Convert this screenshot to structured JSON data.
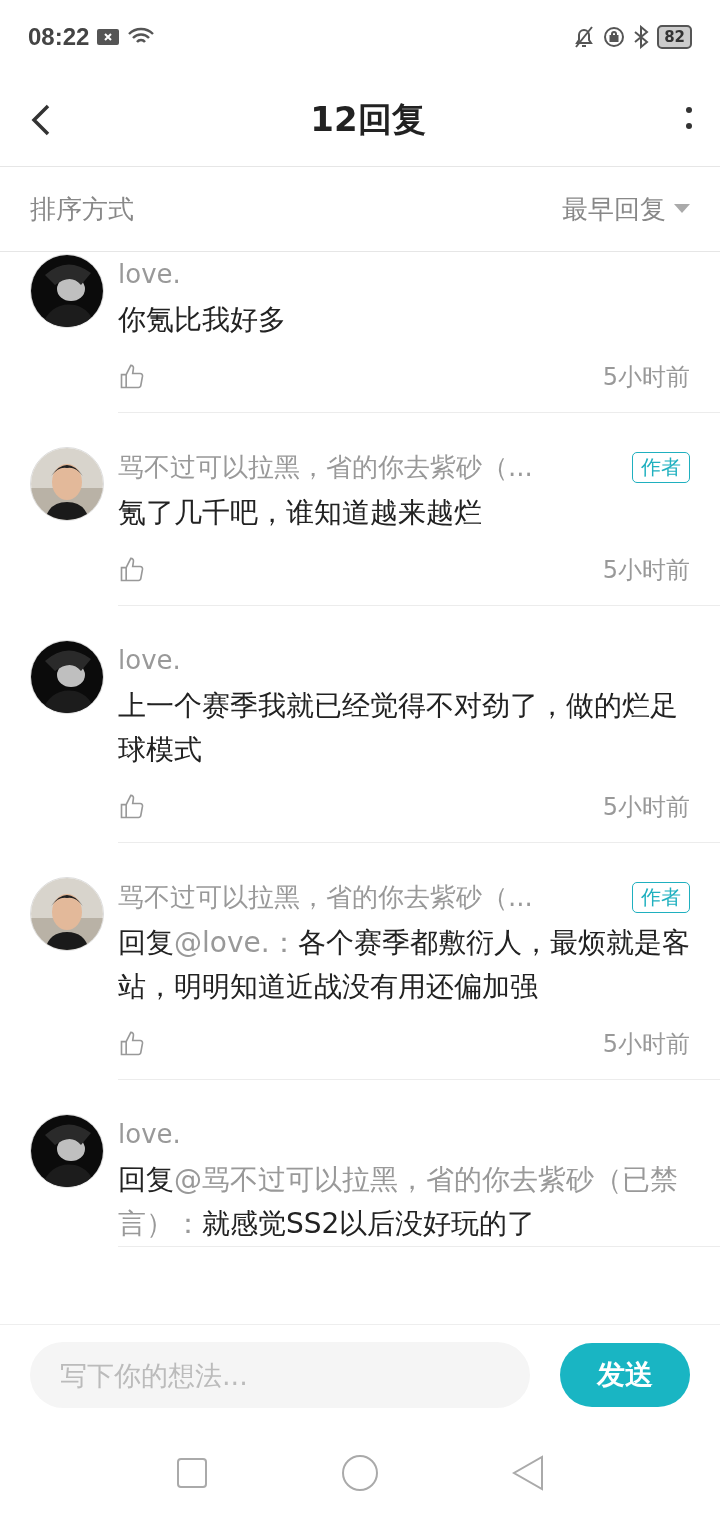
{
  "status_bar": {
    "time": "08:22",
    "battery": "82"
  },
  "header": {
    "title": "12回复"
  },
  "sort_bar": {
    "label": "排序方式",
    "value": "最早回复"
  },
  "comments": [
    {
      "name": "love.",
      "text": "你氪比我好多",
      "time": "5小时前"
    },
    {
      "name": "骂不过可以拉黑，省的你去紫砂（...",
      "badge": "作者",
      "text": "氪了几千吧，谁知道越来越烂",
      "time": "5小时前"
    },
    {
      "name": "love.",
      "text": "上一个赛季我就已经觉得不对劲了，做的烂足球模式",
      "time": "5小时前"
    },
    {
      "name": "骂不过可以拉黑，省的你去紫砂（...",
      "badge": "作者",
      "reply_prefix": "回复",
      "reply_to": "@love.：",
      "text": "各个赛季都敷衍人，最烦就是客站，明明知道近战没有用还偏加强",
      "time": "5小时前"
    },
    {
      "name": "love.",
      "reply_prefix": "回复",
      "reply_to": "@骂不过可以拉黑，省的你去紫砂（已禁言）：",
      "text": "就感觉SS2以后没好玩的了"
    }
  ],
  "composer": {
    "placeholder": "写下你的想法...",
    "send": "发送"
  }
}
